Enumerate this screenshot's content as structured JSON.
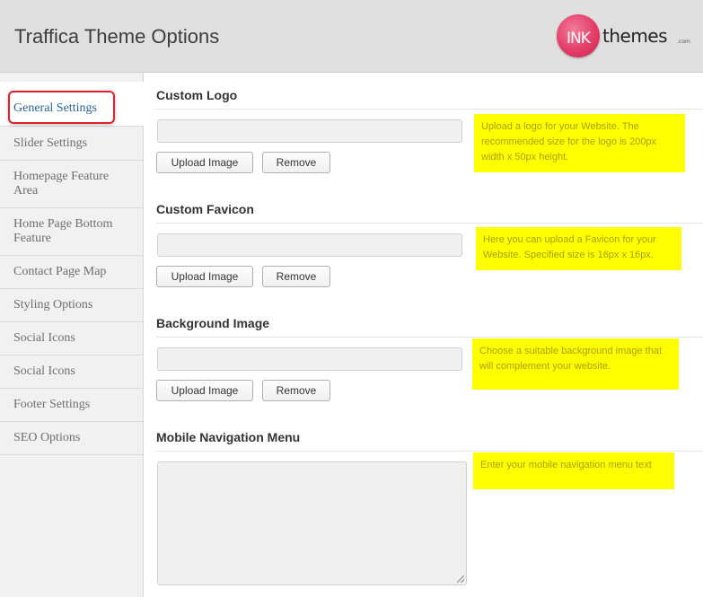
{
  "header": {
    "title": "Traffica Theme Options",
    "logo": {
      "mark": "INK",
      "wordmark": "themes",
      "suffix": ".com",
      "mark_color": "#e33d68"
    }
  },
  "sidebar": {
    "items": [
      {
        "label": "General Settings",
        "active": true
      },
      {
        "label": "Slider Settings"
      },
      {
        "label": "Homepage Feature Area"
      },
      {
        "label": "Home Page Bottom Feature"
      },
      {
        "label": "Contact Page Map"
      },
      {
        "label": "Styling Options"
      },
      {
        "label": "Social Icons"
      },
      {
        "label": "Social Icons"
      },
      {
        "label": "Footer Settings"
      },
      {
        "label": "SEO Options"
      }
    ]
  },
  "main": {
    "sections": [
      {
        "title": "Custom Logo",
        "value": "",
        "upload_label": "Upload Image",
        "remove_label": "Remove",
        "help": "Upload a logo for your Website. The recommended size for the logo is 200px width x 50px height."
      },
      {
        "title": "Custom Favicon",
        "value": "",
        "upload_label": "Upload Image",
        "remove_label": "Remove",
        "help": "Here you can upload a Favicon for your Website. Specified size is 16px x 16px."
      },
      {
        "title": "Background Image",
        "value": "",
        "upload_label": "Upload Image",
        "remove_label": "Remove",
        "help": "Choose a suitable background image that will complement your website."
      },
      {
        "title": "Mobile Navigation Menu",
        "value": "",
        "help": "Enter your mobile navigation menu text"
      }
    ]
  },
  "colors": {
    "highlight_border": "#e0202c",
    "help_background": "#ffff00",
    "help_text": "#a8a000",
    "active_link": "#2a6496"
  }
}
